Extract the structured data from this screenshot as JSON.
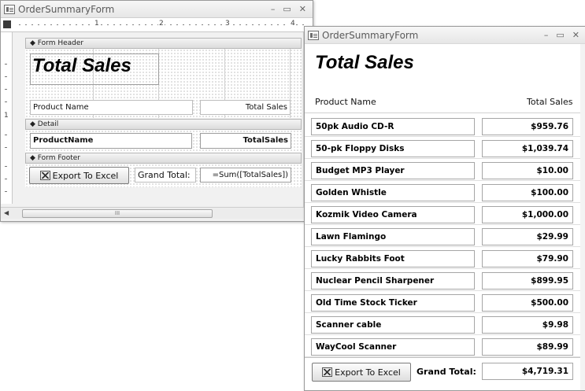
{
  "design_window": {
    "title": "OrderSummaryForm",
    "controls": {
      "minimize": "–",
      "restore": "▭",
      "close": "✕"
    },
    "ruler_numbers": [
      "1",
      "2",
      "3",
      "4"
    ],
    "vertical_ruler_numbers": [
      "1"
    ],
    "sections": {
      "header": "Form Header",
      "detail": "Detail",
      "footer": "Form Footer"
    },
    "header_title": "Total Sales",
    "header_labels": {
      "product": "Product Name",
      "total": "Total Sales"
    },
    "detail_fields": {
      "product": "ProductName",
      "total": "TotalSales"
    },
    "footer": {
      "button": "Export To Excel",
      "grand_label": "Grand Total:",
      "grand_expr": "=Sum([TotalSales])"
    },
    "scrollbar_grip": "III"
  },
  "form_window": {
    "title": "OrderSummaryForm",
    "controls": {
      "minimize": "–",
      "restore": "▭",
      "close": "✕"
    },
    "page_title": "Total Sales",
    "columns": {
      "product": "Product Name",
      "total": "Total Sales"
    },
    "rows": [
      {
        "product": "50pk Audio CD-R",
        "total": "$959.76"
      },
      {
        "product": "50-pk Floppy Disks",
        "total": "$1,039.74"
      },
      {
        "product": "Budget MP3 Player",
        "total": "$10.00"
      },
      {
        "product": "Golden Whistle",
        "total": "$100.00"
      },
      {
        "product": "Kozmik Video Camera",
        "total": "$1,000.00"
      },
      {
        "product": "Lawn Flamingo",
        "total": "$29.99"
      },
      {
        "product": "Lucky Rabbits Foot",
        "total": "$79.90"
      },
      {
        "product": "Nuclear Pencil Sharpener",
        "total": "$899.95"
      },
      {
        "product": "Old Time Stock Ticker",
        "total": "$500.00"
      },
      {
        "product": "Scanner cable",
        "total": "$9.98"
      },
      {
        "product": "WayCool Scanner",
        "total": "$89.99"
      }
    ],
    "footer": {
      "button": "Export To Excel",
      "grand_label": "Grand Total:",
      "grand_value": "$4,719.31"
    }
  }
}
